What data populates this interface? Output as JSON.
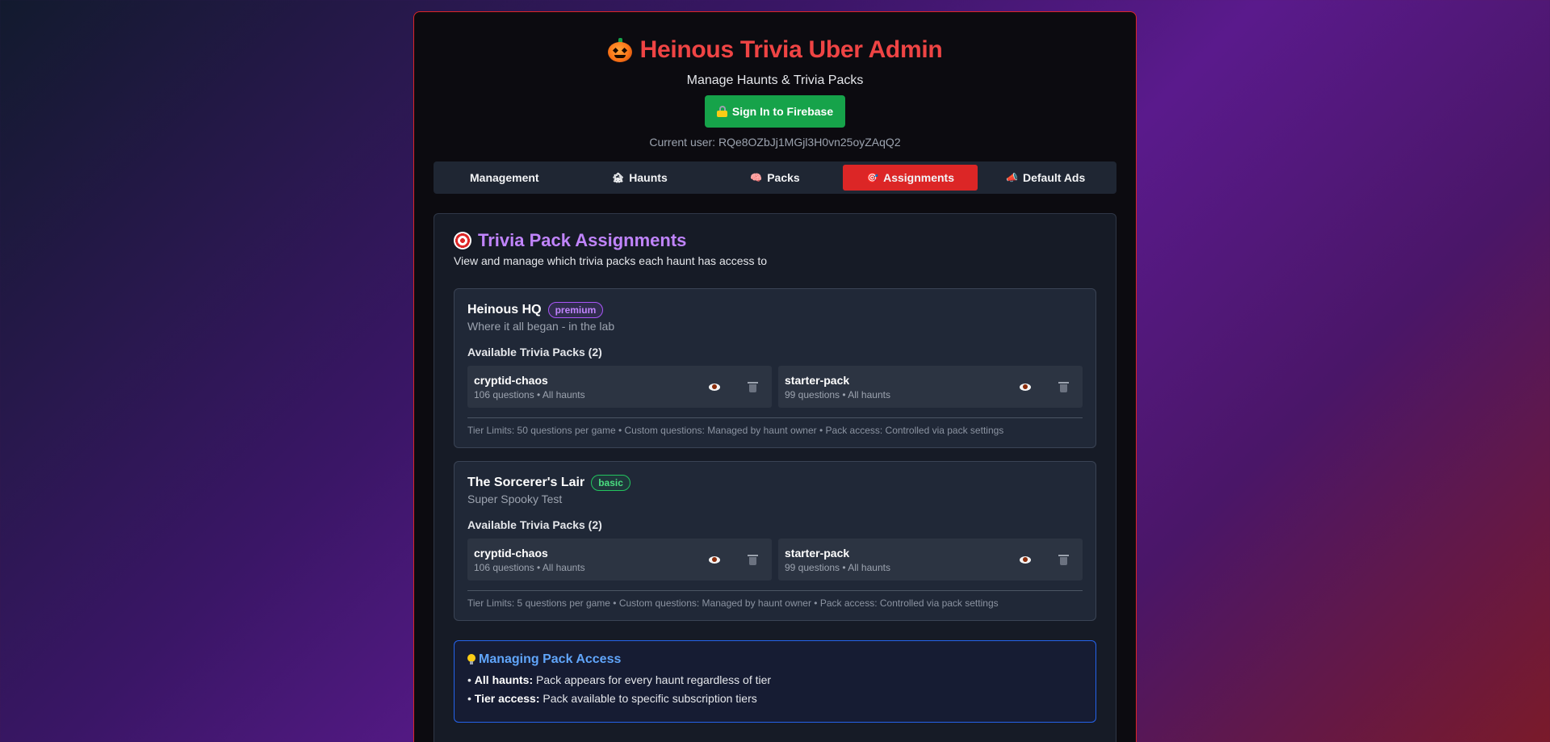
{
  "app": {
    "title": "Heinous Trivia Uber Admin",
    "subtitle": "Manage Haunts & Trivia Packs",
    "signin_label": "Sign In to Firebase",
    "current_user": "Current user: RQe8OZbJj1MGjl3H0vn25oyZAqQ2"
  },
  "tabs": [
    {
      "label": "Management",
      "icon": ""
    },
    {
      "label": "Haunts",
      "icon": "house-icon"
    },
    {
      "label": "Packs",
      "icon": "brain-icon"
    },
    {
      "label": "Assignments",
      "icon": "target-icon",
      "active": true
    },
    {
      "label": "Default Ads",
      "icon": "megaphone-icon"
    }
  ],
  "section": {
    "title": "Trivia Pack Assignments",
    "description": "View and manage which trivia packs each haunt has access to"
  },
  "haunts": [
    {
      "name": "Heinous HQ",
      "tier": "premium",
      "description": "Where it all began - in the lab",
      "packs_label": "Available Trivia Packs (2)",
      "packs": [
        {
          "name": "cryptid-chaos",
          "meta": "106 questions • All haunts"
        },
        {
          "name": "starter-pack",
          "meta": "99 questions • All haunts"
        }
      ],
      "tier_limits": "Tier Limits: 50 questions per game • Custom questions: Managed by haunt owner • Pack access: Controlled via pack settings"
    },
    {
      "name": "The Sorcerer's Lair",
      "tier": "basic",
      "description": "Super Spooky Test",
      "packs_label": "Available Trivia Packs (2)",
      "packs": [
        {
          "name": "cryptid-chaos",
          "meta": "106 questions • All haunts"
        },
        {
          "name": "starter-pack",
          "meta": "99 questions • All haunts"
        }
      ],
      "tier_limits": "Tier Limits: 5 questions per game • Custom questions: Managed by haunt owner • Pack access: Controlled via pack settings"
    }
  ],
  "info": {
    "title": "Managing Pack Access",
    "items": [
      {
        "bold": "All haunts:",
        "text": "Pack appears for every haunt regardless of tier"
      },
      {
        "bold": "Tier access:",
        "text": "Pack available to specific subscription tiers"
      }
    ]
  },
  "colors": {
    "accent_red": "#dc2626",
    "title_red": "#ef4444",
    "purple": "#c084fc",
    "green": "#16a34a",
    "blue": "#60a5fa"
  }
}
